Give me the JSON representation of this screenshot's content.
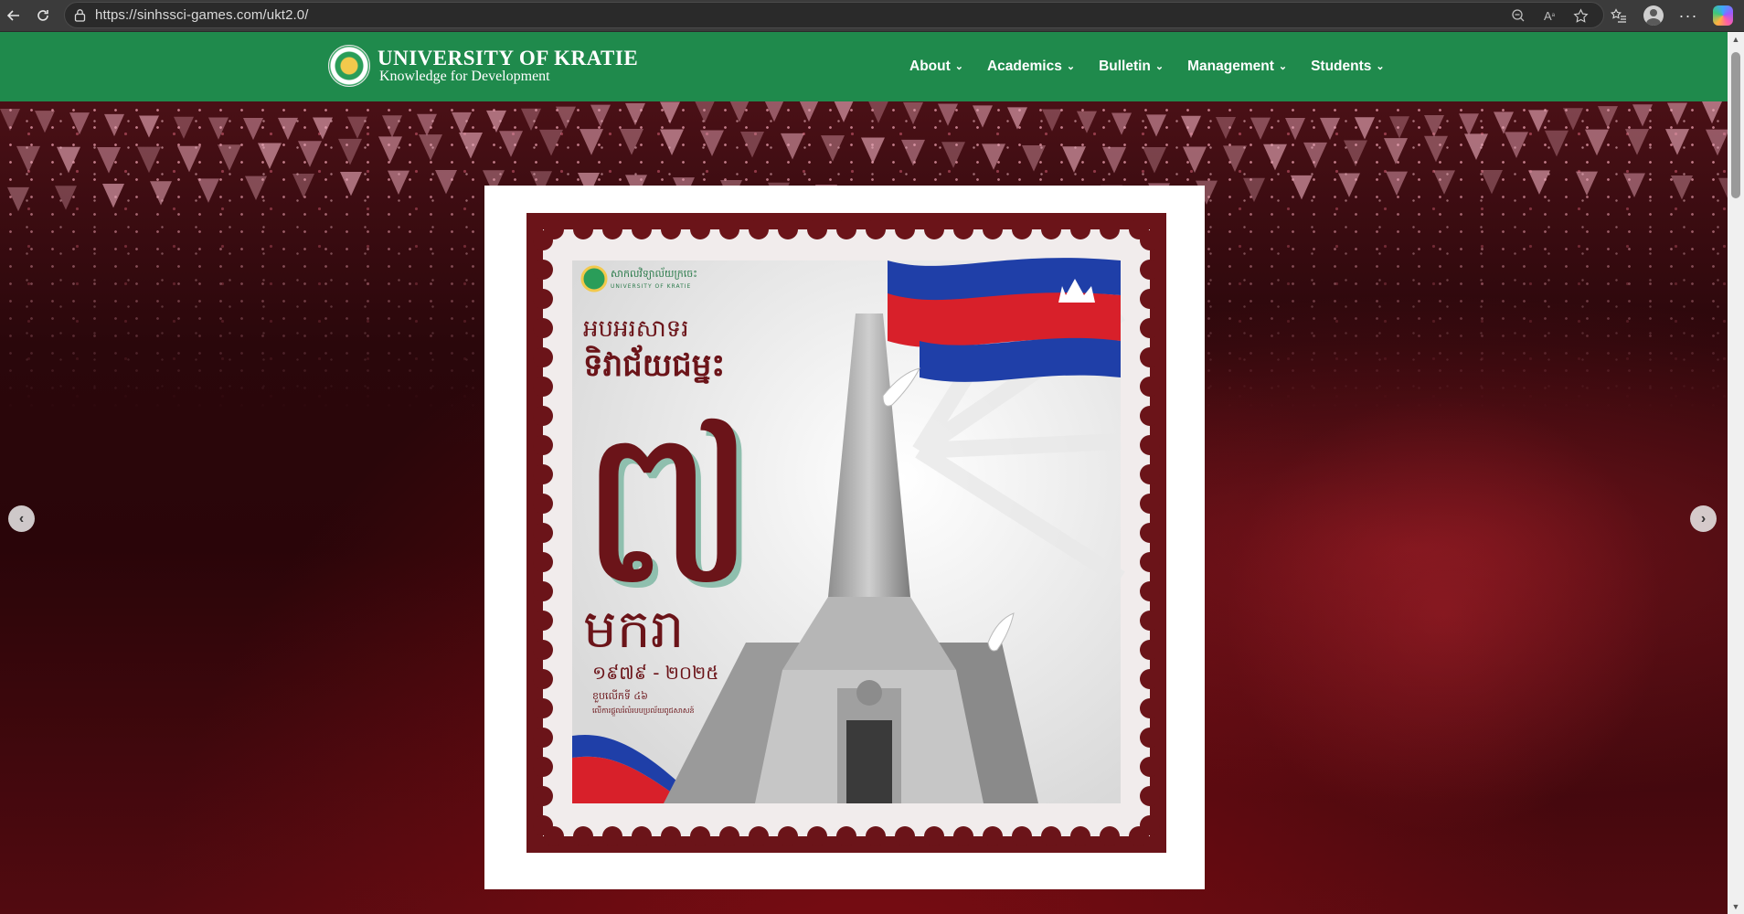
{
  "browser": {
    "url": "https://sinhssci-games.com/ukt2.0/",
    "icons": [
      "back-arrow-icon",
      "refresh-icon",
      "lock-icon",
      "zoom-out-icon",
      "read-aloud-icon",
      "favorite-star-icon",
      "favorites-list-icon",
      "profile-avatar-icon",
      "more-menu-icon",
      "copilot-icon"
    ]
  },
  "site": {
    "title": "UNIVERSITY OF KRATIE",
    "tagline": "Knowledge for Development",
    "nav": [
      {
        "label": "About"
      },
      {
        "label": "Academics"
      },
      {
        "label": "Bulletin"
      },
      {
        "label": "Management"
      },
      {
        "label": "Students"
      }
    ]
  },
  "hero": {
    "prev_icon": "chevron-left-icon",
    "next_icon": "chevron-right-icon",
    "slide": {
      "logo_text_khmer": "សាកលវិទ្យាល័យក្រចេះ",
      "logo_text_en": "UNIVERSITY OF KRATIE",
      "headline_line1": "អបអរសាទរ",
      "headline_line2": "ទិវាជ័យជម្នះ",
      "big_numeral": "៧",
      "month": "មករា",
      "years": "១៩៧៩ - ២០២៥",
      "anniversary": "ខួបលើកទី ៤៦",
      "caption": "លើការផ្តួលរំលំរបបប្រល័យពូជសាសន៍"
    }
  },
  "colors": {
    "header_green": "#1f8a4c",
    "stamp_maroon": "#6b1419",
    "hero_red": "#520a10"
  }
}
